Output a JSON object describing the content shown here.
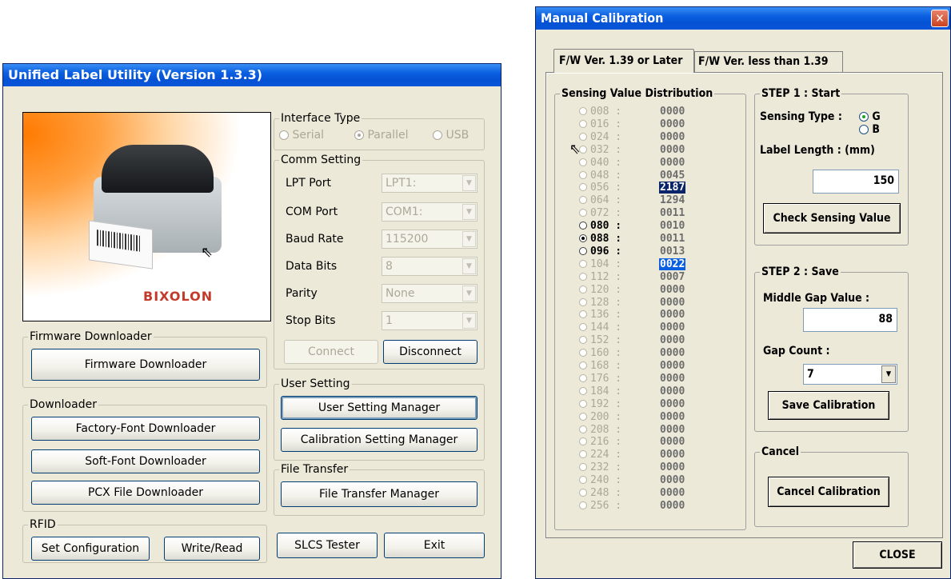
{
  "utility": {
    "title": "Unified Label Utility  (Version 1.3.3)",
    "logo_text": "BIXOLON",
    "interface_type": {
      "label": "Interface Type",
      "options": [
        "Serial",
        "Parallel",
        "USB"
      ],
      "selected": "Parallel"
    },
    "comm_setting": {
      "label": "Comm Setting",
      "fields": [
        {
          "label": "LPT Port",
          "value": "LPT1:"
        },
        {
          "label": "COM Port",
          "value": "COM1:"
        },
        {
          "label": "Baud Rate",
          "value": "115200"
        },
        {
          "label": "Data Bits",
          "value": "8"
        },
        {
          "label": "Parity",
          "value": "None"
        },
        {
          "label": "Stop Bits",
          "value": "1"
        }
      ],
      "connect": "Connect",
      "disconnect": "Disconnect"
    },
    "firmware": {
      "label": "Firmware Downloader",
      "button": "Firmware Downloader"
    },
    "downloader": {
      "label": "Downloader",
      "buttons": [
        "Factory-Font Downloader",
        "Soft-Font Downloader",
        "PCX File Downloader"
      ]
    },
    "rfid": {
      "label": "RFID",
      "set_config": "Set Configuration",
      "write_read": "Write/Read"
    },
    "user_setting": {
      "label": "User Setting",
      "manager": "User Setting Manager",
      "calibration": "Calibration Setting Manager"
    },
    "file_transfer": {
      "label": "File Transfer",
      "manager": "File Transfer Manager"
    },
    "slcs_tester": "SLCS Tester",
    "exit": "Exit"
  },
  "calibration": {
    "title": "Manual Calibration",
    "tabs": [
      "F/W Ver. 1.39 or Later",
      "F/W Ver. less than 1.39"
    ],
    "distribution_label": "Sensing Value Distribution",
    "rows": [
      {
        "num": "008 :",
        "val": "0000",
        "enabled": false,
        "selected": false,
        "hl": ""
      },
      {
        "num": "016 :",
        "val": "0000",
        "enabled": false,
        "selected": false,
        "hl": ""
      },
      {
        "num": "024 :",
        "val": "0000",
        "enabled": false,
        "selected": false,
        "hl": ""
      },
      {
        "num": "032 :",
        "val": "0000",
        "enabled": false,
        "selected": false,
        "hl": ""
      },
      {
        "num": "040 :",
        "val": "0000",
        "enabled": false,
        "selected": false,
        "hl": ""
      },
      {
        "num": "048 :",
        "val": "0045",
        "enabled": false,
        "selected": false,
        "hl": ""
      },
      {
        "num": "056 :",
        "val": "2187",
        "enabled": false,
        "selected": false,
        "hl": "dark"
      },
      {
        "num": "064 :",
        "val": "1294",
        "enabled": false,
        "selected": false,
        "hl": ""
      },
      {
        "num": "072 :",
        "val": "0011",
        "enabled": false,
        "selected": false,
        "hl": ""
      },
      {
        "num": "080 :",
        "val": "0010",
        "enabled": true,
        "selected": false,
        "hl": ""
      },
      {
        "num": "088 :",
        "val": "0011",
        "enabled": true,
        "selected": true,
        "hl": ""
      },
      {
        "num": "096 :",
        "val": "0013",
        "enabled": true,
        "selected": false,
        "hl": ""
      },
      {
        "num": "104 :",
        "val": "0022",
        "enabled": false,
        "selected": false,
        "hl": "blue"
      },
      {
        "num": "112 :",
        "val": "0007",
        "enabled": false,
        "selected": false,
        "hl": ""
      },
      {
        "num": "120 :",
        "val": "0000",
        "enabled": false,
        "selected": false,
        "hl": ""
      },
      {
        "num": "128 :",
        "val": "0000",
        "enabled": false,
        "selected": false,
        "hl": ""
      },
      {
        "num": "136 :",
        "val": "0000",
        "enabled": false,
        "selected": false,
        "hl": ""
      },
      {
        "num": "144 :",
        "val": "0000",
        "enabled": false,
        "selected": false,
        "hl": ""
      },
      {
        "num": "152 :",
        "val": "0000",
        "enabled": false,
        "selected": false,
        "hl": ""
      },
      {
        "num": "160 :",
        "val": "0000",
        "enabled": false,
        "selected": false,
        "hl": ""
      },
      {
        "num": "168 :",
        "val": "0000",
        "enabled": false,
        "selected": false,
        "hl": ""
      },
      {
        "num": "176 :",
        "val": "0000",
        "enabled": false,
        "selected": false,
        "hl": ""
      },
      {
        "num": "184 :",
        "val": "0000",
        "enabled": false,
        "selected": false,
        "hl": ""
      },
      {
        "num": "192 :",
        "val": "0000",
        "enabled": false,
        "selected": false,
        "hl": ""
      },
      {
        "num": "200 :",
        "val": "0000",
        "enabled": false,
        "selected": false,
        "hl": ""
      },
      {
        "num": "208 :",
        "val": "0000",
        "enabled": false,
        "selected": false,
        "hl": ""
      },
      {
        "num": "216 :",
        "val": "0000",
        "enabled": false,
        "selected": false,
        "hl": ""
      },
      {
        "num": "224 :",
        "val": "0000",
        "enabled": false,
        "selected": false,
        "hl": ""
      },
      {
        "num": "232 :",
        "val": "0000",
        "enabled": false,
        "selected": false,
        "hl": ""
      },
      {
        "num": "240 :",
        "val": "0000",
        "enabled": false,
        "selected": false,
        "hl": ""
      },
      {
        "num": "248 :",
        "val": "0000",
        "enabled": false,
        "selected": false,
        "hl": ""
      },
      {
        "num": "256 :",
        "val": "0000",
        "enabled": false,
        "selected": false,
        "hl": ""
      }
    ],
    "step1": {
      "label": "STEP 1 : Start",
      "sensing_type_label": "Sensing Type :",
      "sensing_options": [
        "G",
        "B"
      ],
      "sensing_selected": "G",
      "label_length_label": "Label Length : (mm)",
      "label_length_value": "150",
      "check_button": "Check Sensing Value"
    },
    "step2": {
      "label": "STEP 2 : Save",
      "middle_gap_label": "Middle Gap Value :",
      "middle_gap_value": "88",
      "gap_count_label": "Gap Count :",
      "gap_count_value": "7",
      "save_button": "Save Calibration"
    },
    "cancel": {
      "label": "Cancel",
      "button": "Cancel Calibration"
    },
    "close": "CLOSE",
    "close_icon": "close-icon"
  }
}
